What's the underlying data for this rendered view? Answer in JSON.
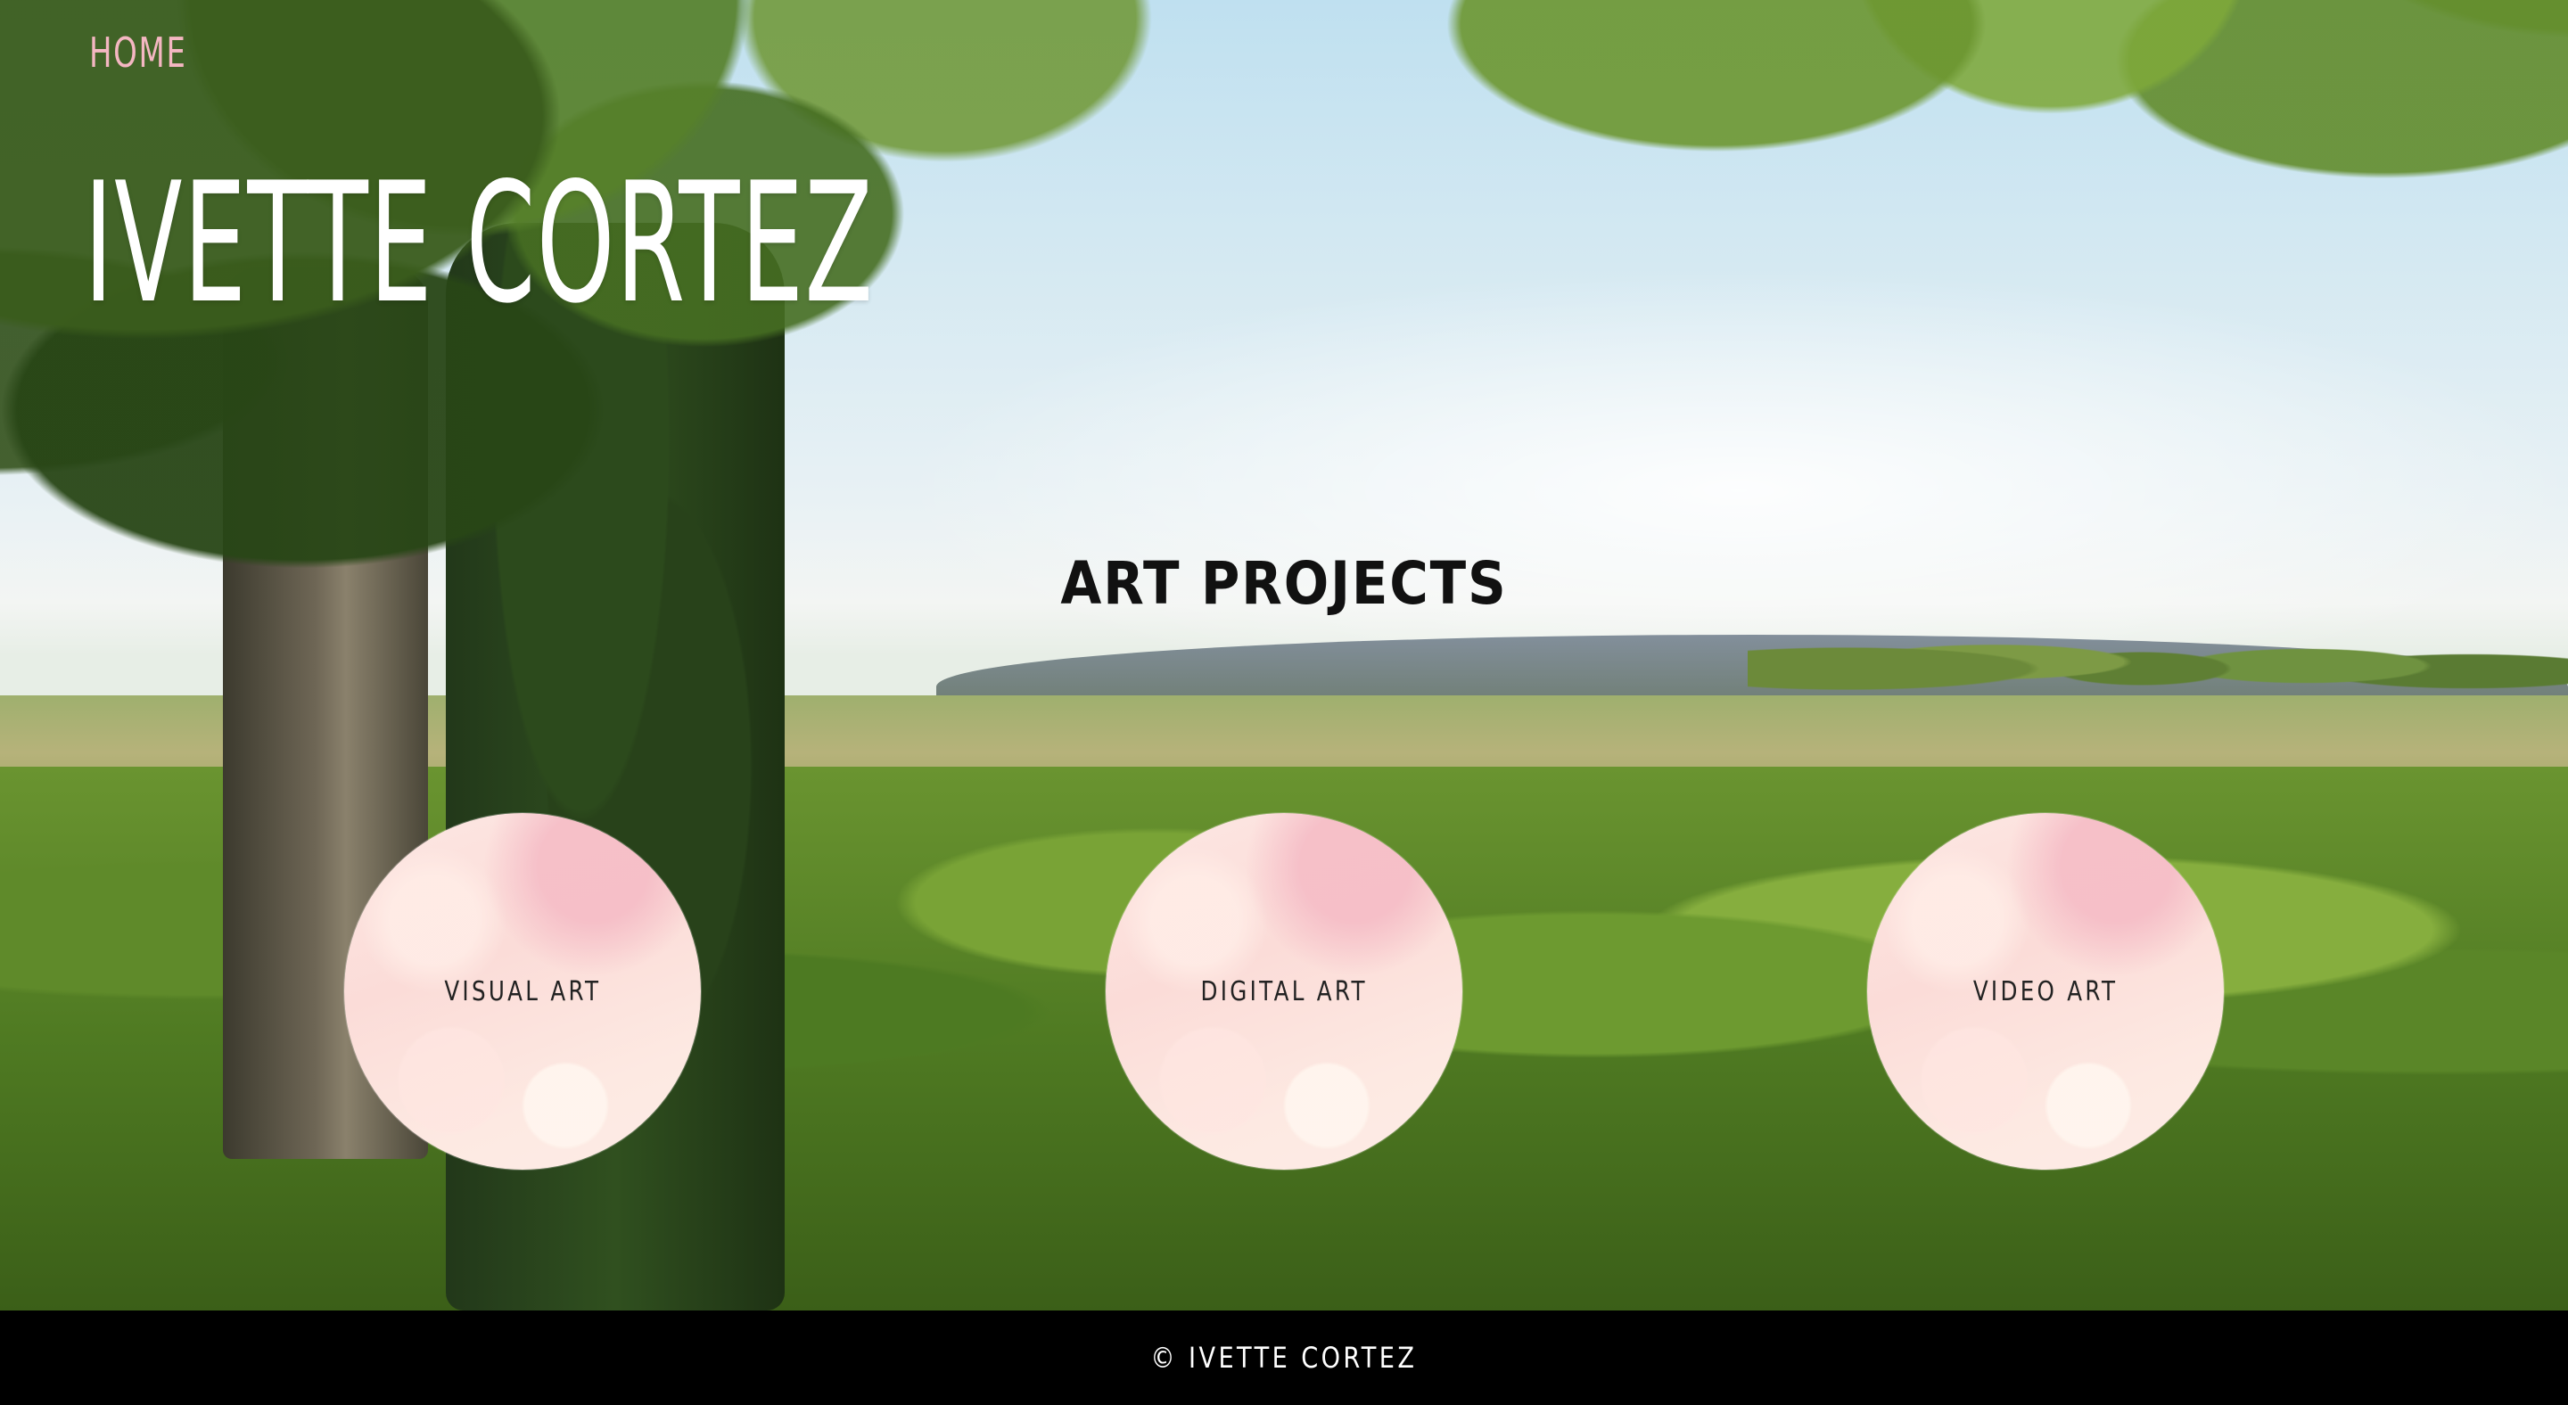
{
  "nav": {
    "home_label": "HOME"
  },
  "header": {
    "site_title": "IVETTE CORTEZ"
  },
  "main": {
    "section_title": "ART PROJECTS",
    "projects": [
      {
        "label": "VISUAL ART"
      },
      {
        "label": "DIGITAL ART"
      },
      {
        "label": "VIDEO ART"
      }
    ]
  },
  "footer": {
    "copyright": "© IVETTE CORTEZ"
  },
  "colors": {
    "nav_link": "#f4b7c2",
    "title": "#ffffff",
    "section_title": "#111111",
    "circle_fill": "#fbdcd8",
    "footer_bg": "#000000",
    "footer_text": "#ffffff"
  },
  "background": {
    "image_description_icon": "nature-landscape-photo"
  }
}
